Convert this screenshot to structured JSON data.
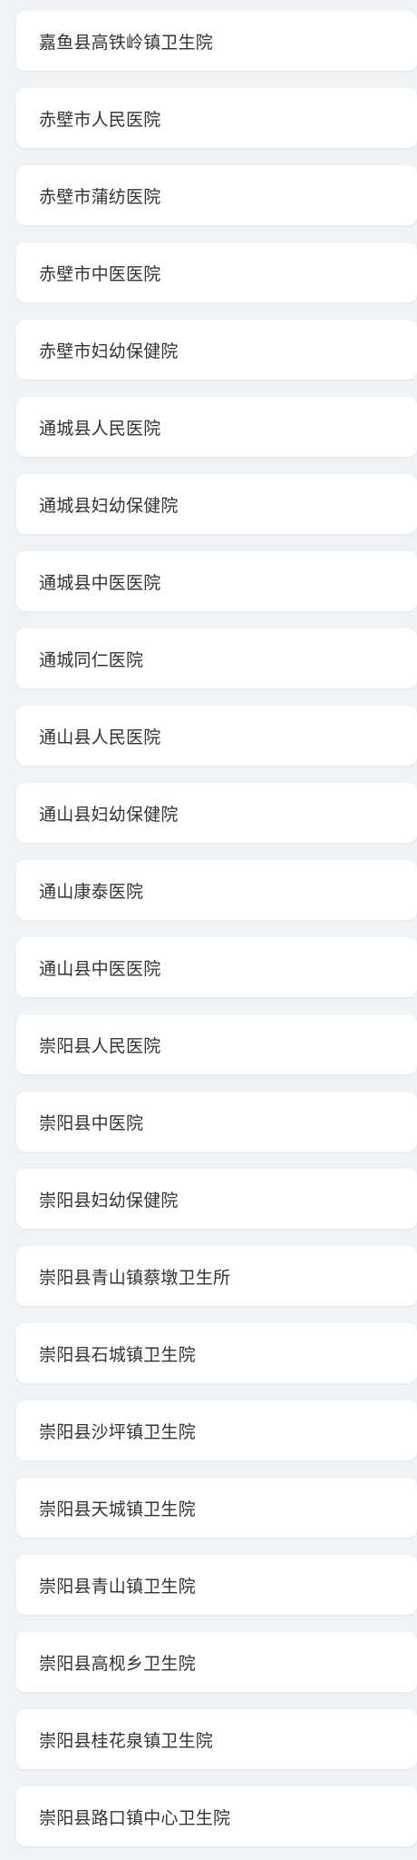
{
  "hospitals": [
    {
      "name": "嘉鱼县高铁岭镇卫生院"
    },
    {
      "name": "赤壁市人民医院"
    },
    {
      "name": "赤壁市蒲纺医院"
    },
    {
      "name": "赤壁市中医医院"
    },
    {
      "name": "赤壁市妇幼保健院"
    },
    {
      "name": "通城县人民医院"
    },
    {
      "name": "通城县妇幼保健院"
    },
    {
      "name": "通城县中医医院"
    },
    {
      "name": "通城同仁医院"
    },
    {
      "name": "通山县人民医院"
    },
    {
      "name": "通山县妇幼保健院"
    },
    {
      "name": "通山康泰医院"
    },
    {
      "name": "通山县中医医院"
    },
    {
      "name": "崇阳县人民医院"
    },
    {
      "name": "崇阳县中医院"
    },
    {
      "name": "崇阳县妇幼保健院"
    },
    {
      "name": "崇阳县青山镇蔡墩卫生所"
    },
    {
      "name": "崇阳县石城镇卫生院"
    },
    {
      "name": "崇阳县沙坪镇卫生院"
    },
    {
      "name": "崇阳县天城镇卫生院"
    },
    {
      "name": "崇阳县青山镇卫生院"
    },
    {
      "name": "崇阳县高枧乡卫生院"
    },
    {
      "name": "崇阳县桂花泉镇卫生院"
    },
    {
      "name": "崇阳县路口镇中心卫生院"
    }
  ]
}
